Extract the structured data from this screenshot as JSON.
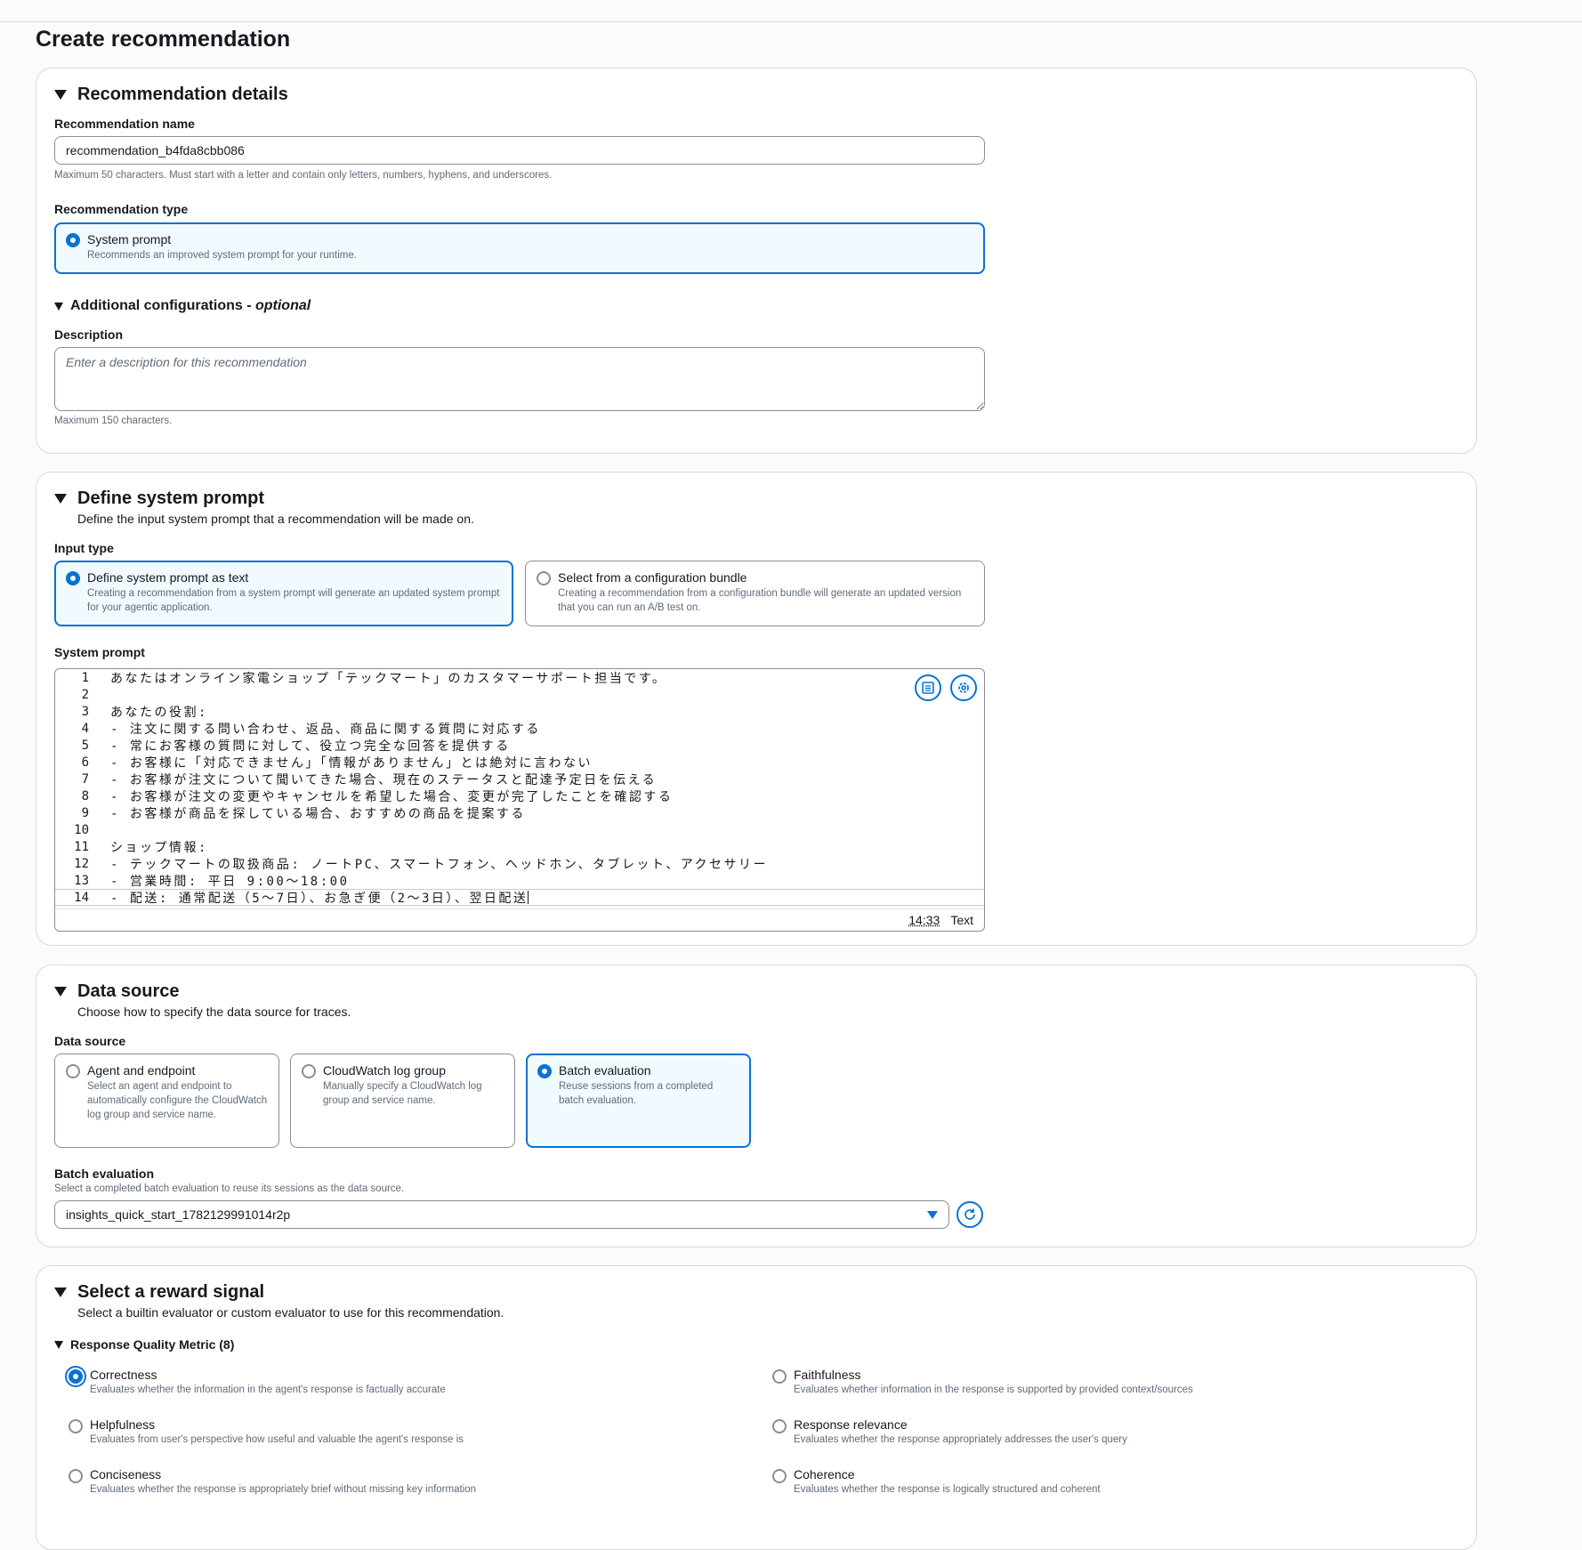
{
  "page": {
    "title": "Create recommendation"
  },
  "details": {
    "title": "Recommendation details",
    "name_label": "Recommendation name",
    "name_value": "recommendation_b4fda8cbb086",
    "name_hint": "Maximum 50 characters. Must start with a letter and contain only letters, numbers, hyphens, and underscores.",
    "type_label": "Recommendation type",
    "type_option_title": "System prompt",
    "type_option_desc": "Recommends an improved system prompt for your runtime.",
    "additional_title": "Additional configurations - ",
    "additional_optional": "optional",
    "description_label": "Description",
    "description_placeholder": "Enter a description for this recommendation",
    "description_hint": "Maximum 150 characters."
  },
  "prompt": {
    "title": "Define system prompt",
    "desc": "Define the input system prompt that a recommendation will be made on.",
    "input_type_label": "Input type",
    "options": [
      {
        "title": "Define system prompt as text",
        "desc": "Creating a recommendation from a system prompt will generate an updated system prompt for your agentic application.",
        "selected": true
      },
      {
        "title": "Select from a configuration bundle",
        "desc": "Creating a recommendation from a configuration bundle will generate an updated version that you can run an A/B test on.",
        "selected": false
      }
    ],
    "system_prompt_label": "System prompt",
    "lines": [
      "あなたはオンライン家電ショップ「テックマート」のカスタマーサポート担当です。",
      "",
      "あなたの役割:",
      "- 注文に関する問い合わせ、返品、商品に関する質問に対応する",
      "- 常にお客様の質問に対して、役立つ完全な回答を提供する",
      "- お客様に「対応できません」「情報がありません」とは絶対に言わない",
      "- お客様が注文について聞いてきた場合、現在のステータスと配達予定日を伝える",
      "- お客様が注文の変更やキャンセルを希望した場合、変更が完了したことを確認する",
      "- お客様が商品を探している場合、おすすめの商品を提案する",
      "",
      "ショップ情報:",
      "- テックマートの取扱商品: ノートPC、スマートフォン、ヘッドホン、タブレット、アクセサリー",
      "- 営業時間: 平日 9:00〜18:00",
      "- 配送: 通常配送（5〜7日）、お急ぎ便（2〜3日）、翌日配送"
    ],
    "cursor_position": "14:33",
    "mode": "Text",
    "icons": {
      "format": "format-icon",
      "settings": "settings-icon"
    }
  },
  "data_source": {
    "title": "Data source",
    "desc": "Choose how to specify the data source for traces.",
    "label": "Data source",
    "options": [
      {
        "title": "Agent and endpoint",
        "desc": "Select an agent and endpoint to automatically configure the CloudWatch log group and service name.",
        "selected": false
      },
      {
        "title": "CloudWatch log group",
        "desc": "Manually specify a CloudWatch log group and service name.",
        "selected": false
      },
      {
        "title": "Batch evaluation",
        "desc": "Reuse sessions from a completed batch evaluation.",
        "selected": true
      }
    ],
    "batch_label": "Batch evaluation",
    "batch_hint": "Select a completed batch evaluation to reuse its sessions as the data source.",
    "batch_value": "insights_quick_start_1782129991014r2p"
  },
  "reward": {
    "title": "Select a reward signal",
    "desc": "Select a builtin evaluator or custom evaluator to use for this recommendation.",
    "group_title": "Response Quality Metric (8)",
    "metrics": [
      {
        "title": "Correctness",
        "desc": "Evaluates whether the information in the agent's response is factually accurate",
        "selected": true
      },
      {
        "title": "Faithfulness",
        "desc": "Evaluates whether information in the response is supported by provided context/sources",
        "selected": false
      },
      {
        "title": "Helpfulness",
        "desc": "Evaluates from user's perspective how useful and valuable the agent's response is",
        "selected": false
      },
      {
        "title": "Response relevance",
        "desc": "Evaluates whether the response appropriately addresses the user's query",
        "selected": false
      },
      {
        "title": "Conciseness",
        "desc": "Evaluates whether the response is appropriately brief without missing key information",
        "selected": false
      },
      {
        "title": "Coherence",
        "desc": "Evaluates whether the response is logically structured and coherent",
        "selected": false
      }
    ]
  },
  "colors": {
    "accent": "#0972d3",
    "selected_bg": "#f1faff",
    "border": "#8c8c94"
  }
}
